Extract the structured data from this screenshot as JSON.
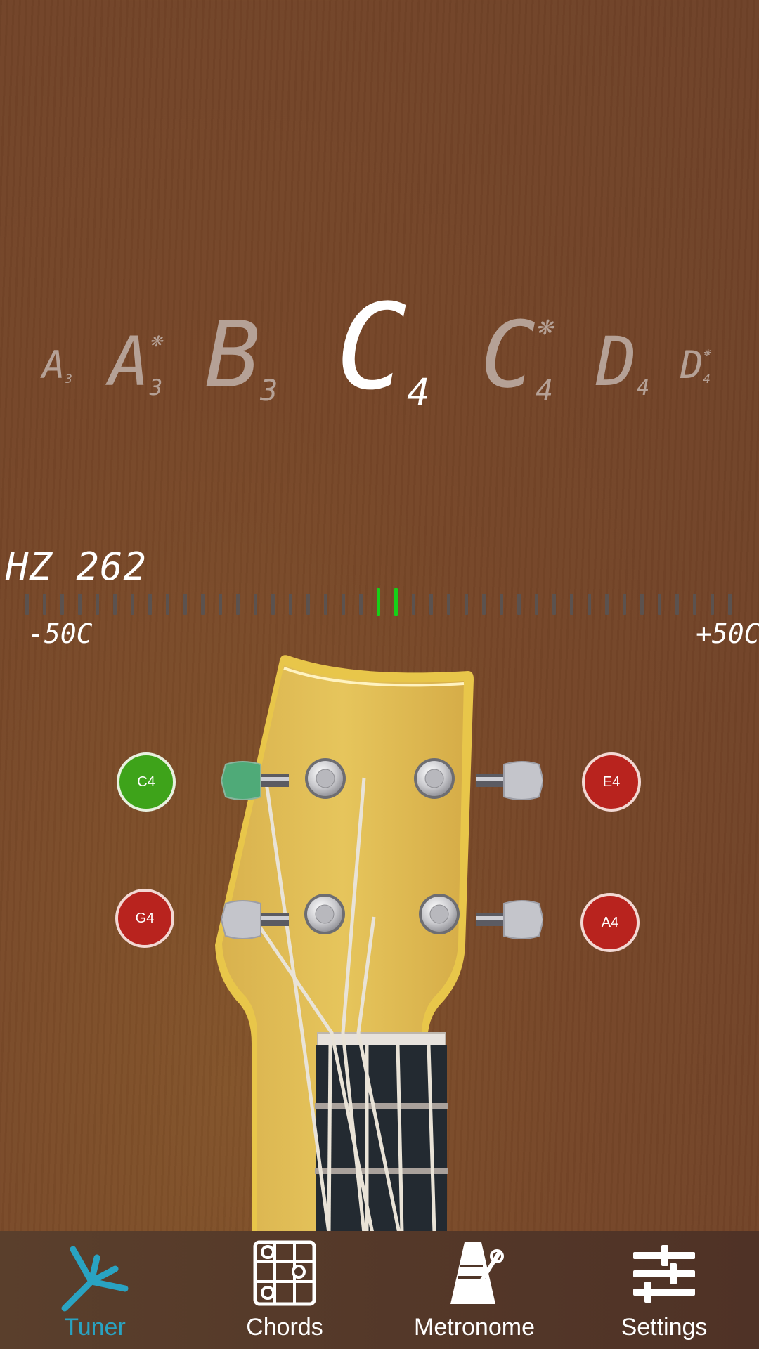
{
  "tuner": {
    "notes": [
      {
        "letter": "A",
        "octave": "3",
        "sharp": ""
      },
      {
        "letter": "A",
        "octave": "3",
        "sharp": "❋"
      },
      {
        "letter": "B",
        "octave": "3",
        "sharp": ""
      },
      {
        "letter": "C",
        "octave": "4",
        "sharp": ""
      },
      {
        "letter": "C",
        "octave": "4",
        "sharp": "❋"
      },
      {
        "letter": "D",
        "octave": "4",
        "sharp": ""
      },
      {
        "letter": "D",
        "octave": "4",
        "sharp": "❋"
      }
    ],
    "active_note_index": 3,
    "frequency_label": "HZ 262",
    "cents_min_label": "-50C",
    "cents_max_label": "+50C",
    "meter_ticks": 41,
    "meter_active_ticks": [
      20,
      21
    ],
    "colors": {
      "active": "#16d017",
      "inactive_tick": "#5b524f",
      "string_ok": "#3ea31a",
      "string_off": "#b8231e"
    }
  },
  "strings": [
    {
      "label": "C4",
      "status": "in-tune"
    },
    {
      "label": "E4",
      "status": "off"
    },
    {
      "label": "G4",
      "status": "off"
    },
    {
      "label": "A4",
      "status": "off"
    }
  ],
  "nav": {
    "items": [
      {
        "label": "Tuner",
        "icon": "tuning-fork-icon",
        "active": true
      },
      {
        "label": "Chords",
        "icon": "chord-grid-icon",
        "active": false
      },
      {
        "label": "Metronome",
        "icon": "metronome-icon",
        "active": false
      },
      {
        "label": "Settings",
        "icon": "sliders-icon",
        "active": false
      }
    ],
    "accent": "#29a3c2"
  }
}
